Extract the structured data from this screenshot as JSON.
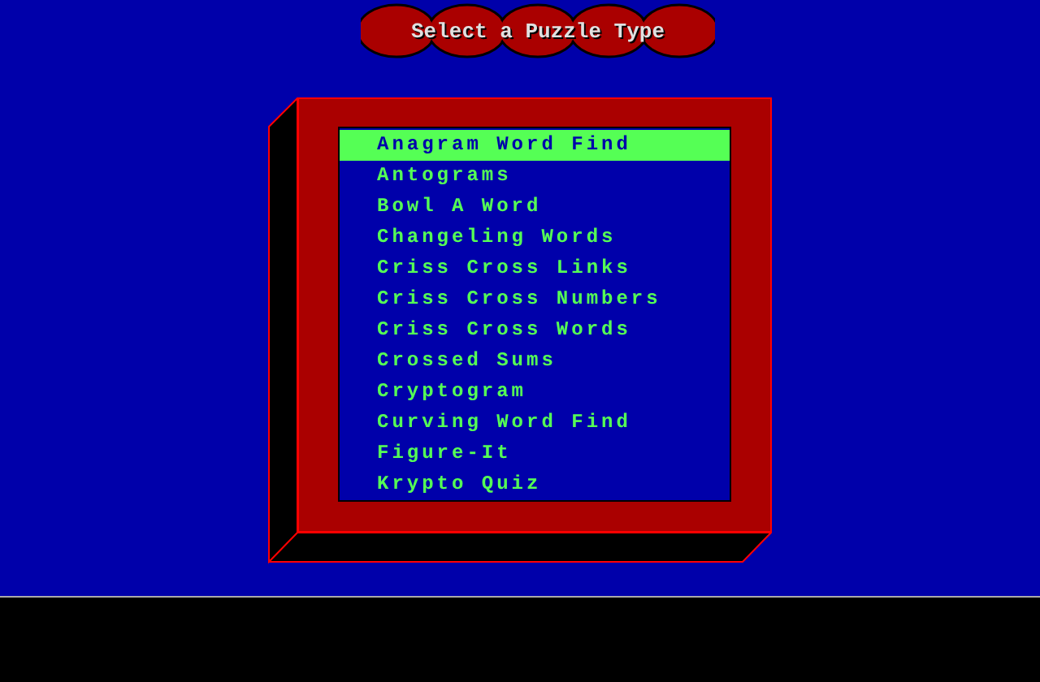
{
  "title": "Select a Puzzle Type",
  "puzzle_types": [
    {
      "label": "Anagram Word Find",
      "selected": true
    },
    {
      "label": "Antograms",
      "selected": false
    },
    {
      "label": "Bowl A Word",
      "selected": false
    },
    {
      "label": "Changeling Words",
      "selected": false
    },
    {
      "label": "Criss Cross Links",
      "selected": false
    },
    {
      "label": "Criss Cross Numbers",
      "selected": false
    },
    {
      "label": "Criss Cross Words",
      "selected": false
    },
    {
      "label": "Crossed Sums",
      "selected": false
    },
    {
      "label": "Cryptogram",
      "selected": false
    },
    {
      "label": "Curving Word Find",
      "selected": false
    },
    {
      "label": "Figure-It",
      "selected": false
    },
    {
      "label": "Krypto Quiz",
      "selected": false
    }
  ]
}
